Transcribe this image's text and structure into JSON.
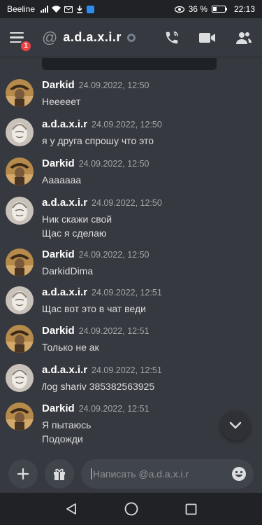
{
  "status_bar": {
    "carrier": "Beeline",
    "battery": "36 %",
    "time": "22:13"
  },
  "header": {
    "menu_badge": "1",
    "channel_symbol": "@",
    "title": "a.d.a.x.i.r",
    "icons": [
      "menu-icon",
      "at-icon",
      "call-icon",
      "video-icon",
      "members-icon"
    ]
  },
  "messages": [
    {
      "author": "Darkid",
      "time": "24.09.2022, 12:50",
      "lines": [
        "Неееeeт"
      ],
      "avatar": "darkid"
    },
    {
      "author": "a.d.a.x.i.r",
      "time": "24.09.2022, 12:50",
      "lines": [
        "я у друга спрошу что это"
      ],
      "avatar": "adaxir"
    },
    {
      "author": "Darkid",
      "time": "24.09.2022, 12:50",
      "lines": [
        "Аааааaa"
      ],
      "avatar": "darkid"
    },
    {
      "author": "a.d.a.x.i.r",
      "time": "24.09.2022, 12:50",
      "lines": [
        "Ник скажи свой",
        "Щас я сделаю"
      ],
      "avatar": "adaxir"
    },
    {
      "author": "Darkid",
      "time": "24.09.2022, 12:50",
      "lines": [
        "DarkidDima"
      ],
      "avatar": "darkid"
    },
    {
      "author": "a.d.a.x.i.r",
      "time": "24.09.2022, 12:51",
      "lines": [
        "Щас вот это в чат веди"
      ],
      "avatar": "adaxir"
    },
    {
      "author": "Darkid",
      "time": "24.09.2022, 12:51",
      "lines": [
        "Только не ак"
      ],
      "avatar": "darkid"
    },
    {
      "author": "a.d.a.x.i.r",
      "time": "24.09.2022, 12:51",
      "lines": [
        "/log shariv 385382563925"
      ],
      "avatar": "adaxir"
    },
    {
      "author": "Darkid",
      "time": "24.09.2022, 12:51",
      "lines": [
        "Я пытаюсь",
        "Подожди"
      ],
      "avatar": "darkid"
    }
  ],
  "composer": {
    "placeholder": "Написать @a.d.a.x.i.r"
  },
  "colors": {
    "background": "#36393f",
    "bar": "#202225",
    "input": "#40444b",
    "badge": "#ed4245"
  }
}
